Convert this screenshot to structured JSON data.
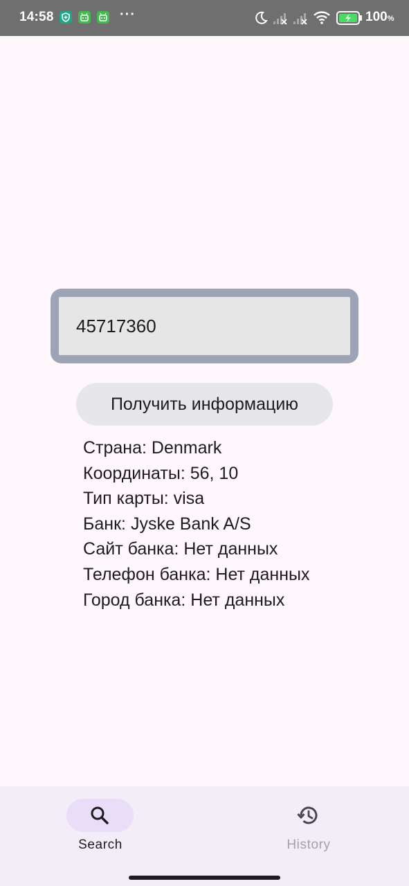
{
  "status_bar": {
    "time": "14:58",
    "more": "···",
    "battery_percent": "100",
    "battery_unit": "%"
  },
  "search": {
    "input_value": "45717360",
    "button_label": "Получить информацию"
  },
  "results": [
    "Страна: Denmark",
    "Координаты: 56, 10",
    "Тип карты: visa",
    "Банк: Jyske Bank A/S",
    "Сайт банка: Нет данных",
    "Телефон банка: Нет данных",
    "Город банка: Нет данных"
  ],
  "bottom_nav": {
    "items": [
      {
        "label": "Search",
        "icon": "search-icon",
        "selected": true
      },
      {
        "label": "History",
        "icon": "history-icon",
        "selected": false
      }
    ]
  },
  "colors": {
    "background": "#FEF7FC",
    "status_bar": "#6F6F6F",
    "input_border": "#9EA3B6",
    "input_fill": "#E6E6E6",
    "button_fill": "#E7E6E8",
    "nav_background": "#F3EDF7",
    "nav_active_pill": "#E8DEF8",
    "nav_inactive_text": "#A3A0A8"
  }
}
